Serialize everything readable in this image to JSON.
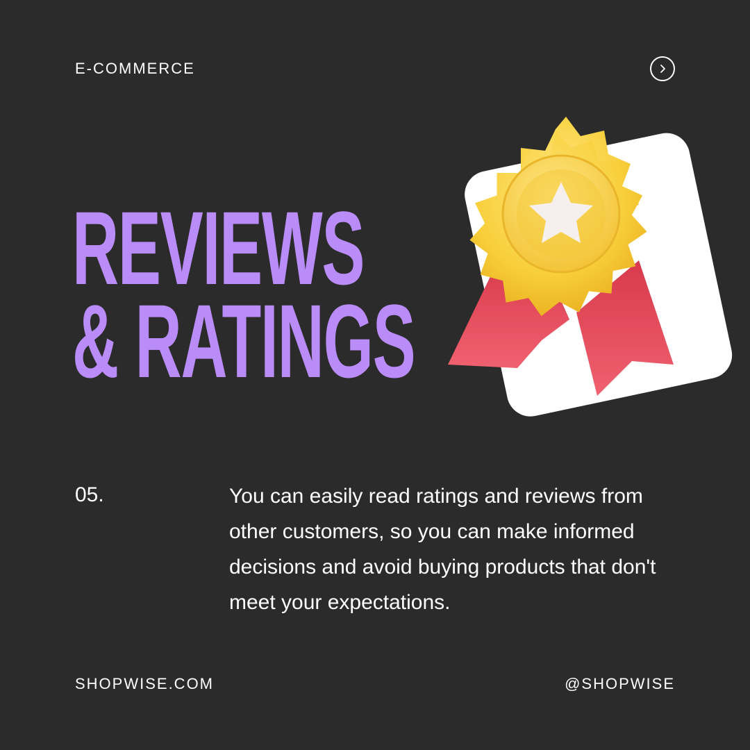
{
  "header": {
    "category": "E-COMMERCE",
    "next_icon": "chevron-right-circle-icon"
  },
  "title": {
    "line1": "REVIEWS",
    "line2": "& RATINGS",
    "color": "#b98cf7"
  },
  "illustration": {
    "icon": "award-badge-star-icon",
    "badge_color": "#f7cf3a",
    "ribbon_color": "#e84f5e",
    "card_color": "#ffffff"
  },
  "content": {
    "number": "05.",
    "text": "You can easily read ratings and reviews from other customers, so you can make informed decisions and avoid buying products that don't meet your expectations."
  },
  "footer": {
    "website": "SHOPWISE.COM",
    "handle": "@SHOPWISE"
  },
  "colors": {
    "background": "#2b2b2b",
    "text": "#ffffff"
  }
}
